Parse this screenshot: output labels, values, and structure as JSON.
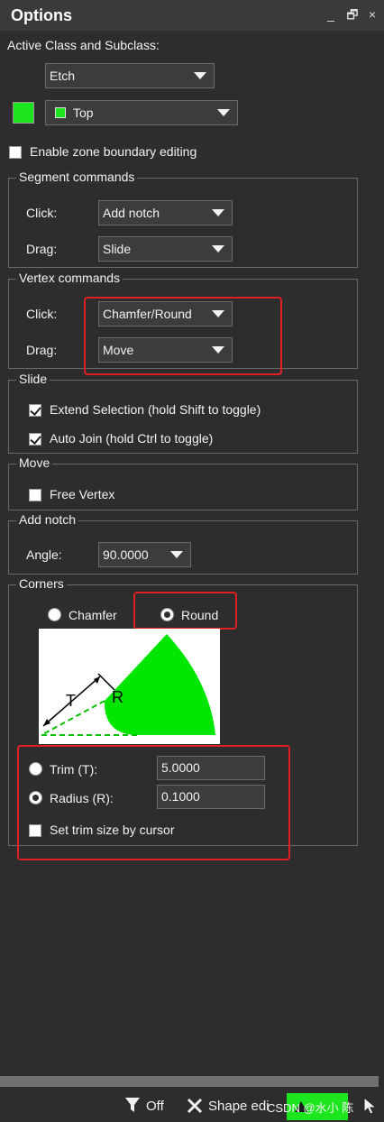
{
  "window": {
    "title": "Options",
    "controls": {
      "minimize": "_",
      "restore": "🗗",
      "close": "×"
    }
  },
  "active_class": {
    "label": "Active Class and Subclass:",
    "class_value": "Etch",
    "subclass_value": "Top",
    "color": "#1ee61e"
  },
  "zone": {
    "label": "Enable zone boundary editing",
    "checked": false
  },
  "segment": {
    "legend": "Segment commands",
    "click_label": "Click:",
    "click_value": "Add notch",
    "drag_label": "Drag:",
    "drag_value": "Slide"
  },
  "vertex": {
    "legend": "Vertex commands",
    "click_label": "Click:",
    "click_value": "Chamfer/Round",
    "drag_label": "Drag:",
    "drag_value": "Move"
  },
  "slide": {
    "legend": "Slide",
    "extend_label": "Extend Selection (hold Shift to toggle)",
    "extend_checked": true,
    "autojoin_label": "Auto Join (hold Ctrl to toggle)",
    "autojoin_checked": true
  },
  "move": {
    "legend": "Move",
    "free_vertex_label": "Free Vertex",
    "free_vertex_checked": false
  },
  "add_notch": {
    "legend": "Add notch",
    "angle_label": "Angle:",
    "angle_value": "90.0000"
  },
  "corners": {
    "legend": "Corners",
    "chamfer_label": "Chamfer",
    "round_label": "Round",
    "selected": "Round",
    "diagram": {
      "t_label": "T",
      "r_label": "R"
    },
    "trim_label": "Trim (T):",
    "trim_value": "5.0000",
    "radius_label": "Radius (R):",
    "radius_value": "0.1000",
    "mode_selected": "Radius",
    "set_trim_label": "Set trim size by cursor",
    "set_trim_checked": false
  },
  "statusbar": {
    "filter_label": "Off",
    "shape_edit_label": "Shape edi",
    "watermark": "CSDN @水小 陈"
  }
}
